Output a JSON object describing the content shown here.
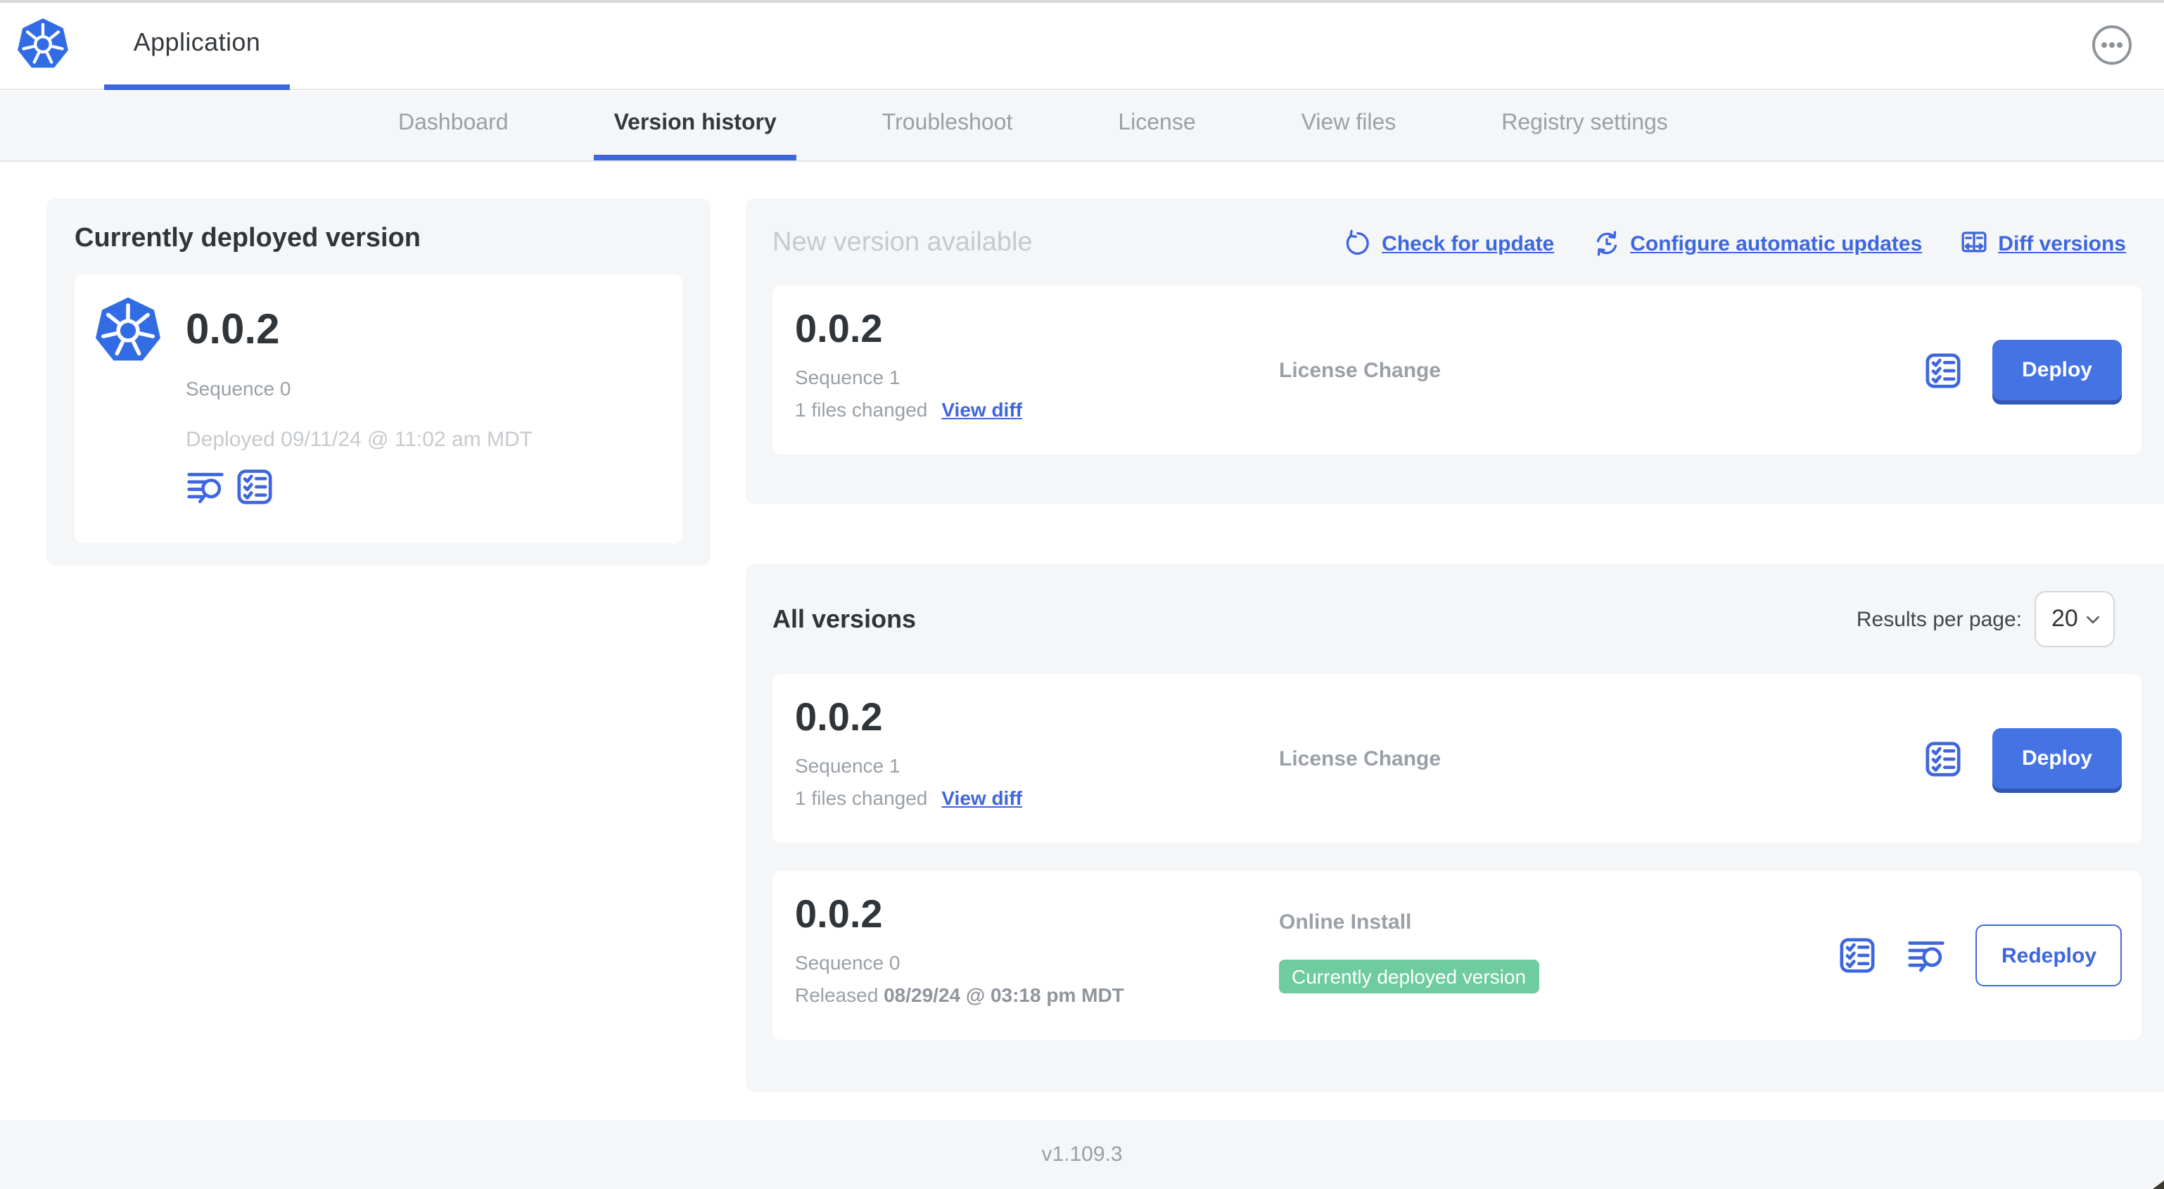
{
  "header": {
    "app_title": "Application",
    "menu_icon": "ellipsis-menu-icon"
  },
  "nav": {
    "tabs": [
      {
        "label": "Dashboard",
        "active": false
      },
      {
        "label": "Version history",
        "active": true
      },
      {
        "label": "Troubleshoot",
        "active": false
      },
      {
        "label": "License",
        "active": false
      },
      {
        "label": "View files",
        "active": false
      },
      {
        "label": "Registry settings",
        "active": false
      }
    ]
  },
  "current_version": {
    "title": "Currently deployed version",
    "version": "0.0.2",
    "sequence": "Sequence 0",
    "deployed": "Deployed 09/11/24 @ 11:02 am MDT",
    "icons": [
      "view-logs-icon",
      "release-notes-icon"
    ]
  },
  "new_version": {
    "title": "New version available",
    "actions": {
      "check_for_update": "Check for update",
      "configure_automatic_updates": "Configure automatic updates",
      "diff_versions": "Diff versions"
    },
    "row": {
      "version": "0.0.2",
      "sequence": "Sequence 1",
      "files_changed": "1 files changed",
      "view_diff": "View diff",
      "source": "License Change",
      "action": "Deploy"
    }
  },
  "all_versions": {
    "title": "All versions",
    "results_per_page": {
      "label": "Results per page:",
      "value": "20"
    },
    "rows": [
      {
        "version": "0.0.2",
        "sequence": "Sequence 1",
        "files_changed": "1 files changed",
        "view_diff": "View diff",
        "source": "License Change",
        "action": "Deploy"
      },
      {
        "version": "0.0.2",
        "sequence": "Sequence 0",
        "released_label": "Released",
        "released_date": "08/29/24 @ 03:18 pm MDT",
        "source": "Online Install",
        "badge": "Currently deployed version",
        "action": "Redeploy"
      }
    ]
  },
  "footer": {
    "app_version": "v1.109.3"
  },
  "colors": {
    "primary_blue": "#3e66dd",
    "button_blue": "#4673e3",
    "kubernetes_blue": "#326ce5",
    "badge_green": "#6fcba0",
    "panel_gray": "#f4f6f8",
    "muted_text": "#9aa0a6",
    "light_text": "#c6cace",
    "dark_text": "#30353a"
  }
}
